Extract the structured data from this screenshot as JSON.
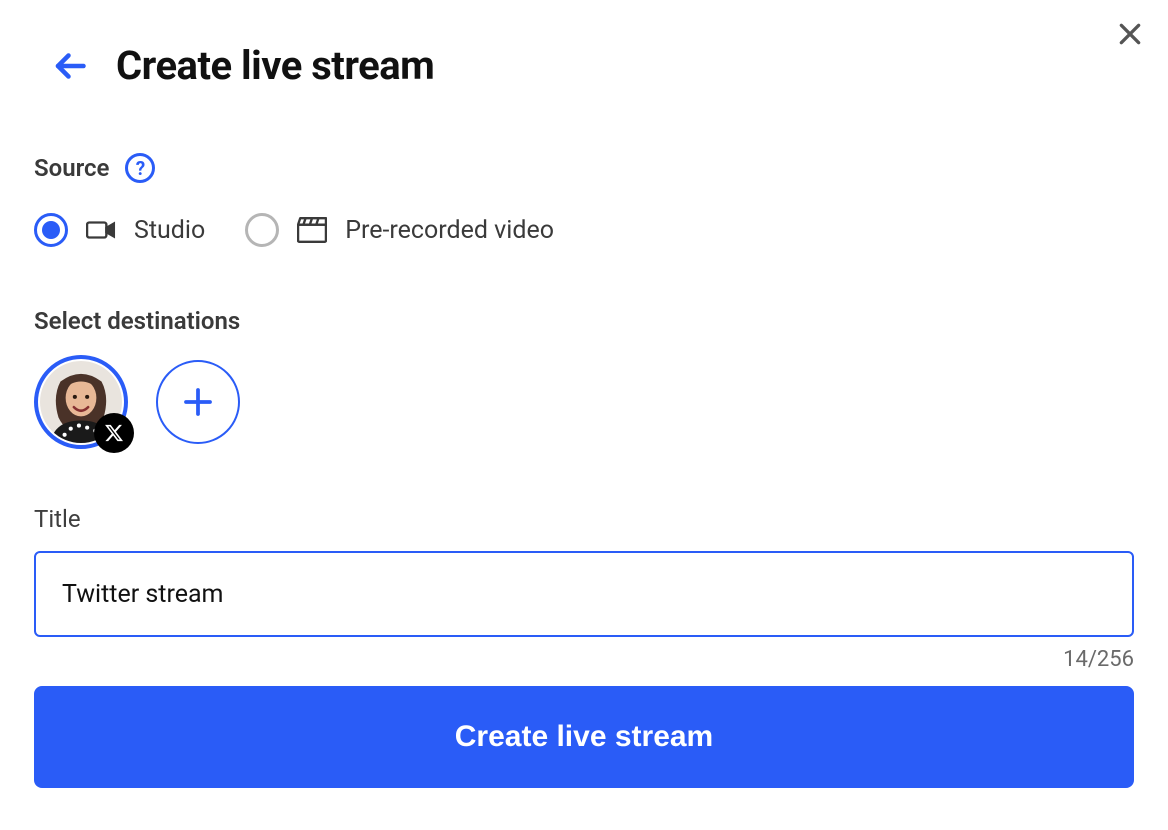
{
  "header": {
    "title": "Create live stream"
  },
  "source": {
    "label": "Source",
    "help_icon": "?",
    "options": [
      {
        "id": "studio",
        "label": "Studio",
        "icon": "camera-icon",
        "selected": true
      },
      {
        "id": "pre",
        "label": "Pre-recorded video",
        "icon": "clapper-icon",
        "selected": false
      }
    ]
  },
  "destinations": {
    "label": "Select destinations",
    "items": [
      {
        "platform_badge": "x-logo-icon",
        "selected": true
      }
    ]
  },
  "titleField": {
    "label": "Title",
    "value": "Twitter stream",
    "counter": "14/256"
  },
  "submit_label": "Create live stream"
}
